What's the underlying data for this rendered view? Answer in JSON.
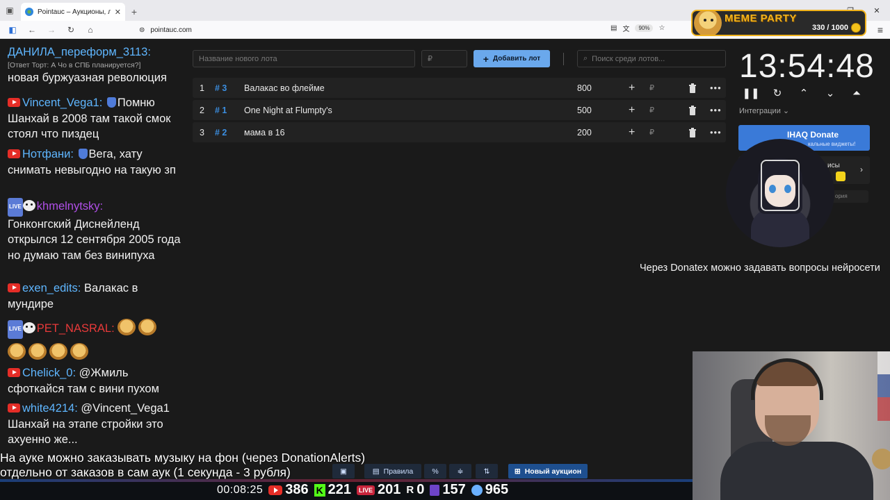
{
  "browser": {
    "tab_title": "Pointauc – Аукционы, лотереи",
    "url": "pointauc.com",
    "zoom": "90%"
  },
  "overlay": {
    "meme_title": "MEME PARTY",
    "meme_count": "330 / 1000"
  },
  "chat": {
    "messages": [
      {
        "nick": "ДАНИЛА_переформ_3113:",
        "reply": "[Ответ Торт: А Чо в СПБ планируется?]",
        "text": "новая буржуазная революция"
      },
      {
        "nick": "Vincent_Vega1:",
        "text1": "Помню",
        "text": "Шанхай в 2008 там такой смок стоял что пиздец"
      },
      {
        "nick": "Нотфани:",
        "text1": "Вега, хату",
        "text": "снимать невыгодно на такую зп"
      },
      {
        "nick": "khmelnytsky:",
        "text": "Гонконгский Диснейленд открылся 12 сентября 2005 года но думаю там без винипуха"
      },
      {
        "nick": "exen_edits:",
        "text1": "Валакас в",
        "text": "мундире"
      },
      {
        "nick": "PET_NASRAL:"
      },
      {
        "nick": "Chelick_0:",
        "text1": "@Жмиль",
        "text": "сфоткайся там с вини пухом"
      },
      {
        "nick": "white4214:",
        "text1": "@Vincent_Vega1",
        "text": "Шанхай на этапе стройки это ахуенно же..."
      }
    ],
    "live_label": "LIVE"
  },
  "auction": {
    "lot_name_placeholder": "Название нового лота",
    "amount_placeholder": "₽",
    "add_button": "Добавить лот",
    "search_placeholder": "Поиск среди лотов...",
    "lots": [
      {
        "n": "1",
        "id": "# 3",
        "name": "Валакас во флейме",
        "amount": "800",
        "currency": "₽"
      },
      {
        "n": "2",
        "id": "# 1",
        "name": "One Night at Flumpty's",
        "amount": "500",
        "currency": "₽"
      },
      {
        "n": "3",
        "id": "# 2",
        "name": "мама в 16",
        "amount": "200",
        "currency": "₽"
      }
    ]
  },
  "panel": {
    "timer": "13:54:48",
    "integrations": "Интеграции",
    "ihaq_title": "IHAQ Donate",
    "ihaq_sub": "кальные виджеты!",
    "services": "исы",
    "history": "ория"
  },
  "ticker": "Через Donatex можно задавать вопросы нейросети",
  "bottom": {
    "line1": "На ауке можно заказывать музыку на фон (через DonationAlerts)",
    "line2": "отдельно от заказов в сам аук (1 секунда - 3 рубля)",
    "rules": "Правила",
    "new_auction": "Новый аукцион"
  },
  "stats": {
    "uptime": "00:08:25",
    "youtube": "386",
    "kick_label": "K",
    "kick": "221",
    "live_label": "LIVE",
    "live": "201",
    "r_label": "R",
    "r": "0",
    "twitch": "157",
    "viewers": "965"
  },
  "colors": {
    "accent": "#6aa8ec",
    "lot_id": "#3b8ee0",
    "youtube": "#e52d27",
    "meme_gold": "#f3b31c"
  }
}
